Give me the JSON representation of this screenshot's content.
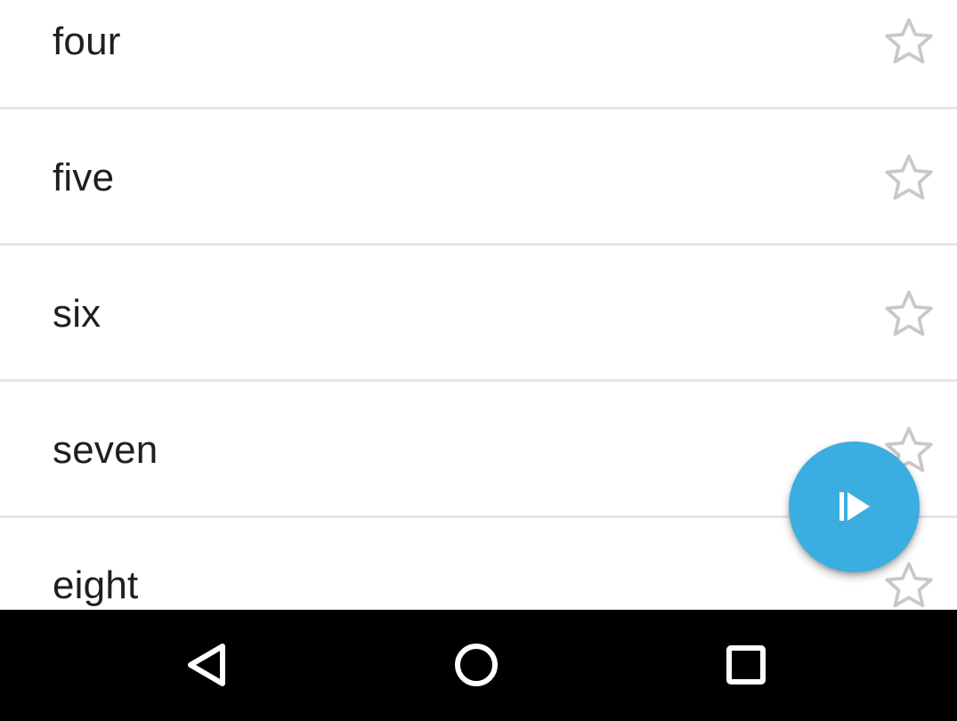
{
  "list": {
    "items": [
      {
        "label": "four",
        "starred": false
      },
      {
        "label": "five",
        "starred": false
      },
      {
        "label": "six",
        "starred": false
      },
      {
        "label": "seven",
        "starred": false
      },
      {
        "label": "eight",
        "starred": false
      }
    ]
  },
  "fab": {
    "icon": "skip-play-icon",
    "color": "#3aaee0"
  },
  "navbar": {
    "back_icon": "back-triangle-icon",
    "home_icon": "home-circle-icon",
    "recents_icon": "recents-square-icon"
  },
  "colors": {
    "star_outline": "#c8c8c8",
    "divider": "#e6e6e6",
    "text": "#1f1f1f",
    "navbar_bg": "#000000"
  }
}
